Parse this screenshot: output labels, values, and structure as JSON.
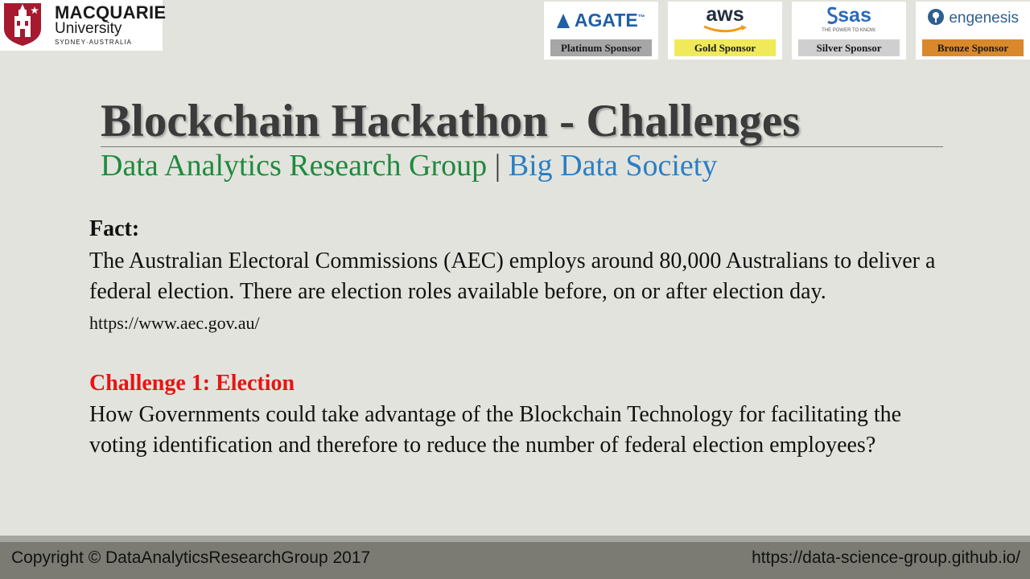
{
  "logo": {
    "name": "MACQUARIE",
    "sub": "University",
    "place": "SYDNEY·AUSTRALIA"
  },
  "sponsors": [
    {
      "logo": "AGATE",
      "mark": "™",
      "badge": "Platinum Sponsor",
      "badge_color": "#a6a6a6"
    },
    {
      "logo": "aws",
      "badge": "Gold Sponsor",
      "badge_color": "#f0ea5a"
    },
    {
      "logo": "sas",
      "tagline": "THE POWER TO KNOW.",
      "badge": "Silver Sponsor",
      "badge_color": "#cfcfcf"
    },
    {
      "logo": "engenesis",
      "badge": "Bronze Sponsor",
      "badge_color": "#d9892b"
    }
  ],
  "title": "Blockchain Hackathon - Challenges",
  "subtitle": {
    "left": "Data Analytics Research Group",
    "sep": "|",
    "right": "Big Data Society"
  },
  "fact": {
    "heading": "Fact:",
    "text": "The Australian Electoral Commissions (AEC) employs around 80,000 Australians to deliver a federal election. There are election roles available before, on or after election day.",
    "url": "https://www.aec.gov.au/"
  },
  "challenge": {
    "heading": "Challenge 1: Election",
    "text": "How Governments could take advantage of the Blockchain Technology for facilitating the voting identification and therefore to reduce the number of federal election employees?"
  },
  "footer": {
    "copyright": "Copyright © DataAnalyticsResearchGroup 2017",
    "url": "https://data-science-group.github.io/"
  }
}
